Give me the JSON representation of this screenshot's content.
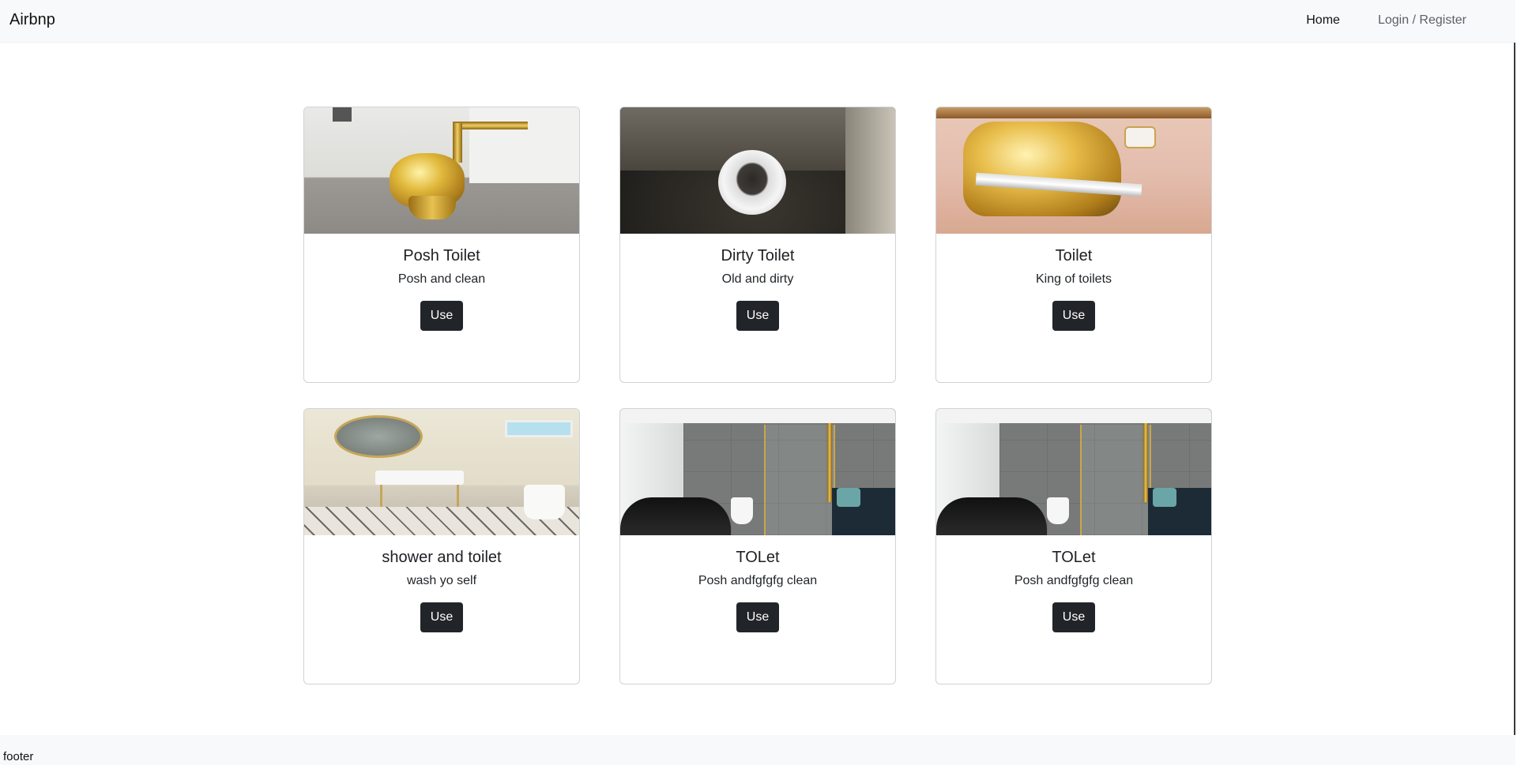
{
  "navbar": {
    "brand": "Airbnp",
    "links": [
      {
        "label": "Home",
        "active": true
      },
      {
        "label": "Login / Register",
        "active": false
      }
    ]
  },
  "cards": [
    {
      "title": "Posh Toilet",
      "text": "Posh and clean",
      "button": "Use",
      "image": "gold-toilet-photo"
    },
    {
      "title": "Dirty Toilet",
      "text": "Old and dirty",
      "button": "Use",
      "image": "dirty-toilet-photo"
    },
    {
      "title": "Toilet",
      "text": "King of toilets",
      "button": "Use",
      "image": "ornate-gold-toilet-photo"
    },
    {
      "title": "shower and toilet",
      "text": "wash yo self",
      "button": "Use",
      "image": "bathroom-photo"
    },
    {
      "title": "TOLet",
      "text": "Posh andfgfgfg clean",
      "button": "Use",
      "image": "modern-bathroom-photo"
    },
    {
      "title": "TOLet",
      "text": "Posh andfgfgfg clean",
      "button": "Use",
      "image": "modern-bathroom-photo"
    }
  ],
  "footer": {
    "text": "footer"
  },
  "colors": {
    "navbar_bg": "#f8f9fa",
    "button_bg": "#212529",
    "button_text": "#ffffff",
    "card_border": "#cfd3d7"
  }
}
